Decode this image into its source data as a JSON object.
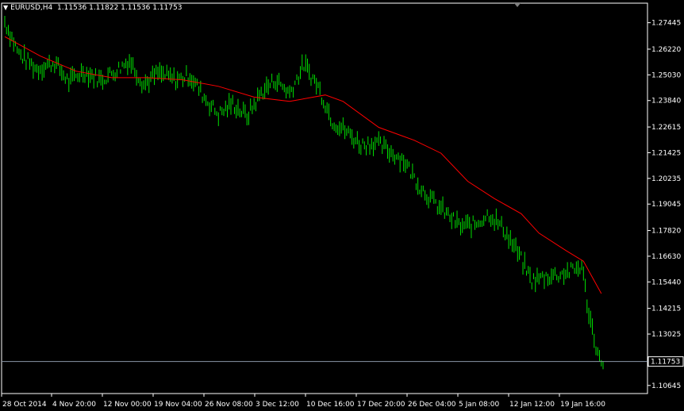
{
  "header": {
    "dropdown_icon": "triangle-down-icon",
    "symbol": "EURUSD,H4",
    "ohlc": "1.11536 1.11822 1.11536 1.11753"
  },
  "colors": {
    "background": "#000000",
    "frame": "#ffffff",
    "bars": "#00e000",
    "moving_average": "#ff0000",
    "bid_line": "#8a96a6",
    "text": "#ffffff"
  },
  "chart_data": {
    "type": "bar",
    "title": "EURUSD,H4",
    "ylim": [
      1.1027,
      1.2835
    ],
    "yticks": [
      "1.27445",
      "1.26220",
      "1.25030",
      "1.23840",
      "1.22615",
      "1.21425",
      "1.20235",
      "1.19045",
      "1.17820",
      "1.16630",
      "1.15440",
      "1.14215",
      "1.13025",
      "1.10645"
    ],
    "xticks": [
      "28 Oct 2014",
      "4 Nov 20:00",
      "12 Nov 00:00",
      "19 Nov 04:00",
      "26 Nov 08:00",
      "3 Dec 12:00",
      "10 Dec 16:00",
      "17 Dec 20:00",
      "26 Dec 04:00",
      "5 Jan 08:00",
      "12 Jan 12:00",
      "19 Jan 16:00"
    ],
    "current_price": "1.11753",
    "grid": false,
    "price_series": [
      {
        "i": 0,
        "v": 1.275
      },
      {
        "i": 8,
        "v": 1.26
      },
      {
        "i": 18,
        "v": 1.253
      },
      {
        "i": 28,
        "v": 1.256
      },
      {
        "i": 36,
        "v": 1.247
      },
      {
        "i": 44,
        "v": 1.252
      },
      {
        "i": 54,
        "v": 1.248
      },
      {
        "i": 62,
        "v": 1.252
      },
      {
        "i": 70,
        "v": 1.257
      },
      {
        "i": 78,
        "v": 1.246
      },
      {
        "i": 86,
        "v": 1.251
      },
      {
        "i": 96,
        "v": 1.248
      },
      {
        "i": 104,
        "v": 1.25
      },
      {
        "i": 112,
        "v": 1.24
      },
      {
        "i": 120,
        "v": 1.232
      },
      {
        "i": 128,
        "v": 1.237
      },
      {
        "i": 136,
        "v": 1.231
      },
      {
        "i": 144,
        "v": 1.242
      },
      {
        "i": 152,
        "v": 1.248
      },
      {
        "i": 160,
        "v": 1.242
      },
      {
        "i": 168,
        "v": 1.255
      },
      {
        "i": 176,
        "v": 1.245
      },
      {
        "i": 184,
        "v": 1.229
      },
      {
        "i": 192,
        "v": 1.224
      },
      {
        "i": 200,
        "v": 1.218
      },
      {
        "i": 208,
        "v": 1.219
      },
      {
        "i": 216,
        "v": 1.215
      },
      {
        "i": 224,
        "v": 1.211
      },
      {
        "i": 232,
        "v": 1.2
      },
      {
        "i": 240,
        "v": 1.192
      },
      {
        "i": 248,
        "v": 1.186
      },
      {
        "i": 256,
        "v": 1.18
      },
      {
        "i": 264,
        "v": 1.181
      },
      {
        "i": 272,
        "v": 1.186
      },
      {
        "i": 280,
        "v": 1.179
      },
      {
        "i": 288,
        "v": 1.168
      },
      {
        "i": 296,
        "v": 1.155
      },
      {
        "i": 304,
        "v": 1.157
      },
      {
        "i": 312,
        "v": 1.158
      },
      {
        "i": 320,
        "v": 1.16
      },
      {
        "i": 324,
        "v": 1.162
      },
      {
        "i": 328,
        "v": 1.14
      },
      {
        "i": 334,
        "v": 1.118
      }
    ],
    "moving_average": [
      {
        "i": 0,
        "v": 1.268
      },
      {
        "i": 20,
        "v": 1.259
      },
      {
        "i": 40,
        "v": 1.252
      },
      {
        "i": 60,
        "v": 1.249
      },
      {
        "i": 80,
        "v": 1.249
      },
      {
        "i": 100,
        "v": 1.248
      },
      {
        "i": 120,
        "v": 1.245
      },
      {
        "i": 140,
        "v": 1.24
      },
      {
        "i": 160,
        "v": 1.238
      },
      {
        "i": 180,
        "v": 1.241
      },
      {
        "i": 190,
        "v": 1.238
      },
      {
        "i": 210,
        "v": 1.226
      },
      {
        "i": 230,
        "v": 1.22
      },
      {
        "i": 245,
        "v": 1.214
      },
      {
        "i": 260,
        "v": 1.201
      },
      {
        "i": 275,
        "v": 1.193
      },
      {
        "i": 290,
        "v": 1.186
      },
      {
        "i": 300,
        "v": 1.177
      },
      {
        "i": 315,
        "v": 1.169
      },
      {
        "i": 325,
        "v": 1.164
      },
      {
        "i": 335,
        "v": 1.149
      }
    ]
  }
}
